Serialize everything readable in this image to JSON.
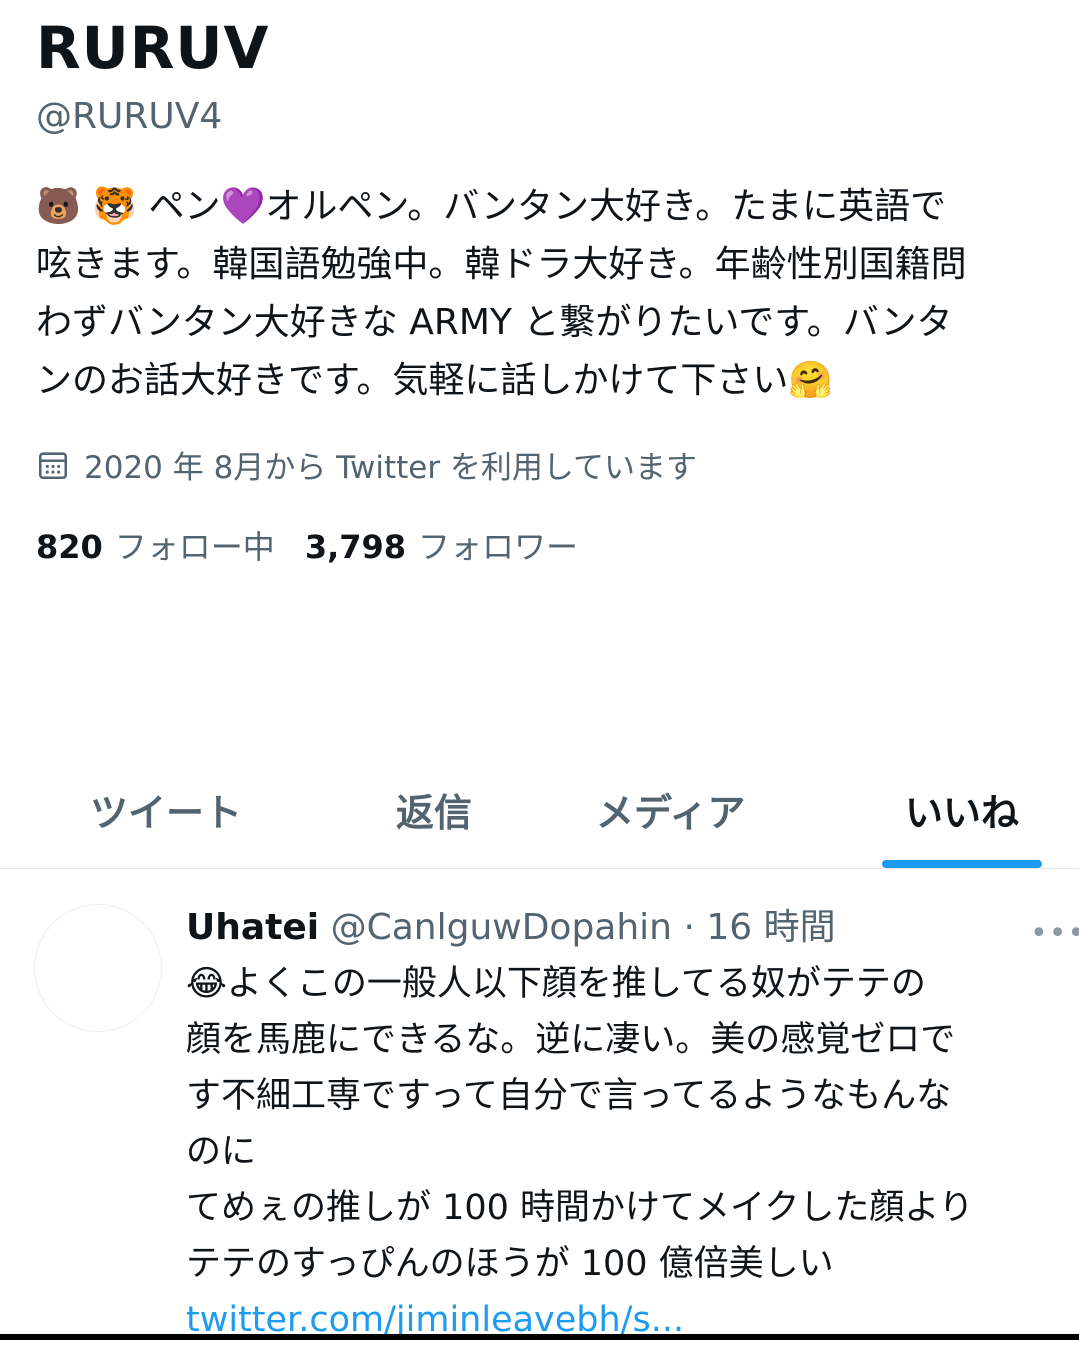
{
  "profile": {
    "display_name": "RURUV",
    "handle": "@RURUV4",
    "bio_lines": [
      "🐻 🐯 ペン💜オルペン。バンタン大好き。たまに英語で",
      "呟きます。韓国語勉強中。韓ドラ大好き。年齢性別国籍問",
      "わずバンタン大好きな ARMY と繋がりたいです。バンタ",
      "ンのお話大好きです。気軽に話しかけて下さい🤗"
    ],
    "joined": "2020 年 8月から Twitter を利用しています",
    "following_count": "820",
    "following_label": "フォロー中",
    "followers_count": "3,798",
    "followers_label": "フォロワー"
  },
  "tabs": [
    {
      "label": "ツイート",
      "active": false
    },
    {
      "label": "返信",
      "active": false
    },
    {
      "label": "メディア",
      "active": false
    },
    {
      "label": "いいね",
      "active": true
    }
  ],
  "tweet": {
    "author": "Uhatei",
    "handle_time": "@CanlguwDopahin · 16 時間",
    "more_icon": "more-icon",
    "lines": [
      "😂よくこの一般人以下顔を推してる奴がテテの",
      "顔を馬鹿にできるな。逆に凄い。美の感覚ゼロで",
      "す不細工専ですって自分で言ってるようなもんな",
      "のに",
      "てめぇの推しが 100 時間かけてメイクした顔より",
      "テテのすっぴんのほうが 100 億倍美しい"
    ],
    "link": "twitter.com/jiminleavebh/s..."
  },
  "colors": {
    "accent": "#1d9bf0",
    "secondary_text": "#536471",
    "primary_text": "#0f1419"
  }
}
